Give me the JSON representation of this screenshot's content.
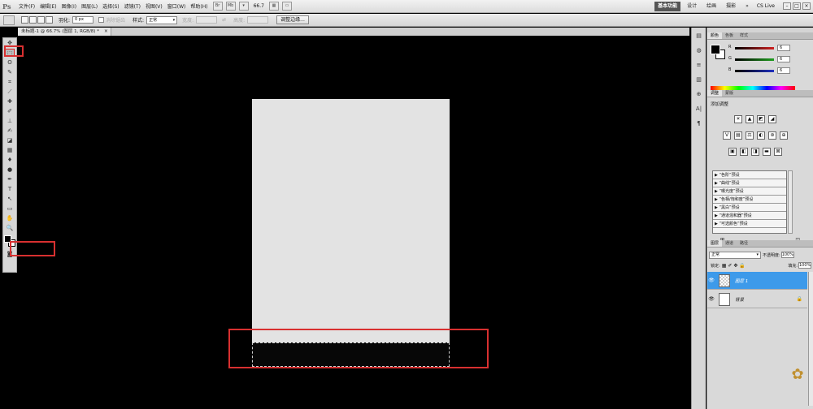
{
  "app": {
    "logo": "Ps",
    "menu": [
      "文件(F)",
      "编辑(E)",
      "图像(I)",
      "图层(L)",
      "选择(S)",
      "滤镜(T)",
      "视图(V)",
      "窗口(W)",
      "帮助(H)"
    ],
    "menubar_buttons": [
      "Br",
      "Mb"
    ],
    "zoom": "66.7",
    "workspaces": [
      "基本功能",
      "设计",
      "绘画",
      "摄影"
    ],
    "active_workspace": "基本功能",
    "cs_live": "CS Live",
    "window_controls": [
      "–",
      "□",
      "×"
    ]
  },
  "options": {
    "feather_label": "羽化:",
    "feather_value": "0 px",
    "antialias_label": "消除锯齿",
    "style_label": "样式:",
    "style_value": "正常",
    "width_label": "宽度:",
    "height_label": "高度:",
    "refine_button": "调整边缘..."
  },
  "document": {
    "tab_title": "未标题-1 @ 66.7% (图层 1, RGB/8) *",
    "close": "×"
  },
  "tools": {
    "icons": [
      "move-icon",
      "marquee-icon",
      "lasso-icon",
      "quick-select-icon",
      "crop-icon",
      "eyedropper-icon",
      "healing-icon",
      "brush-icon",
      "stamp-icon",
      "history-brush-icon",
      "eraser-icon",
      "gradient-icon",
      "blur-icon",
      "dodge-icon",
      "pen-icon",
      "type-icon",
      "path-select-icon",
      "shape-icon",
      "hand-icon",
      "zoom-icon"
    ],
    "glyphs": [
      "✥",
      "⬚",
      "ʘ",
      "✎",
      "⌗",
      "⟋",
      "✚",
      "✐",
      "⊥",
      "✍",
      "◪",
      "▦",
      "♦",
      "●",
      "✒",
      "T",
      "↖",
      "▭",
      "✋",
      "🔍"
    ],
    "selected": 1
  },
  "color_panel": {
    "tabs": [
      "颜色",
      "色板",
      "样式"
    ],
    "sliders": [
      {
        "label": "R",
        "value": "6",
        "color": "#d02020"
      },
      {
        "label": "G",
        "value": "6",
        "color": "#20a020"
      },
      {
        "label": "B",
        "value": "6",
        "color": "#2030c0"
      }
    ]
  },
  "adjust_panel": {
    "tabs": [
      "调整",
      "蒙版"
    ],
    "title": "添加调整",
    "icon_rows": [
      [
        "☀",
        "▲",
        "◩",
        "◢"
      ],
      [
        "V",
        "▤",
        "⚖",
        "◐",
        "⊛",
        "⊕"
      ],
      [
        "▣",
        "◧",
        "◨",
        "▬",
        "⊠"
      ]
    ],
    "presets": [
      "“色阶”预设",
      "“曲线”预设",
      "“曝光度”预设",
      "“色相/饱和度”预设",
      "“黑白”预设",
      "“通道混和器”预设",
      "“可选颜色”预设"
    ],
    "bottom_icons": [
      "⊞",
      "◫"
    ]
  },
  "layers_panel": {
    "tabs": [
      "图层",
      "通道",
      "路径"
    ],
    "blend_mode": "正常",
    "opacity_label": "不透明度:",
    "opacity_value": "100%",
    "lock_label": "锁定:",
    "fill_label": "填充:",
    "fill_value": "100%",
    "layers": [
      {
        "name": "图层 1",
        "active": true,
        "thumb": "checker",
        "eye": "👁"
      },
      {
        "name": "背景",
        "active": false,
        "thumb": "white",
        "eye": "👁",
        "lock": "🔒"
      }
    ]
  },
  "strip_icons": [
    "▤",
    "◍",
    "≡",
    "▥",
    "⊕",
    "A|",
    "¶"
  ]
}
